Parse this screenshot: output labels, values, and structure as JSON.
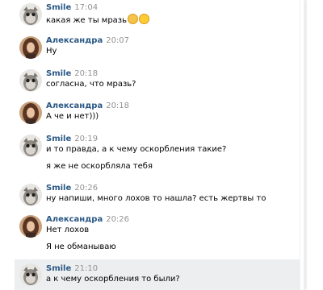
{
  "messages": [
    {
      "name": "Smile",
      "time": "17:04",
      "avatar": "smile-avatar",
      "lines": [
        "какая же ты мразь"
      ],
      "emoji": [
        "grimacing-emoji",
        "grinning-emoji"
      ]
    },
    {
      "name": "Александра",
      "time": "20:07",
      "avatar": "alexandra-avatar",
      "lines": [
        "Ну"
      ]
    },
    {
      "name": "Smile",
      "time": "20:18",
      "avatar": "smile-avatar",
      "lines": [
        "согласна, что мразь?"
      ]
    },
    {
      "name": "Александра",
      "time": "20:18",
      "avatar": "alexandra-avatar",
      "lines": [
        "А че и нет)))"
      ]
    },
    {
      "name": "Smile",
      "time": "20:19",
      "avatar": "smile-avatar",
      "lines": [
        "и то правда, а к чему оскорбления такие?",
        "я же не оскорбляла тебя"
      ]
    },
    {
      "name": "Smile",
      "time": "20:26",
      "avatar": "smile-avatar",
      "lines": [
        "ну напиши, много лохов то нашла? есть жертвы то"
      ]
    },
    {
      "name": "Александра",
      "time": "20:26",
      "avatar": "alexandra-avatar",
      "lines": [
        "Нет лохов",
        "Я не обманываю"
      ]
    },
    {
      "name": "Smile",
      "time": "21:10",
      "avatar": "smile-avatar",
      "lines": [
        "а к чему оскорбления то были?"
      ],
      "highlighted": true
    }
  ],
  "colors": {
    "name": "#2a5885",
    "time": "#939393",
    "highlight": "#edeef0"
  }
}
